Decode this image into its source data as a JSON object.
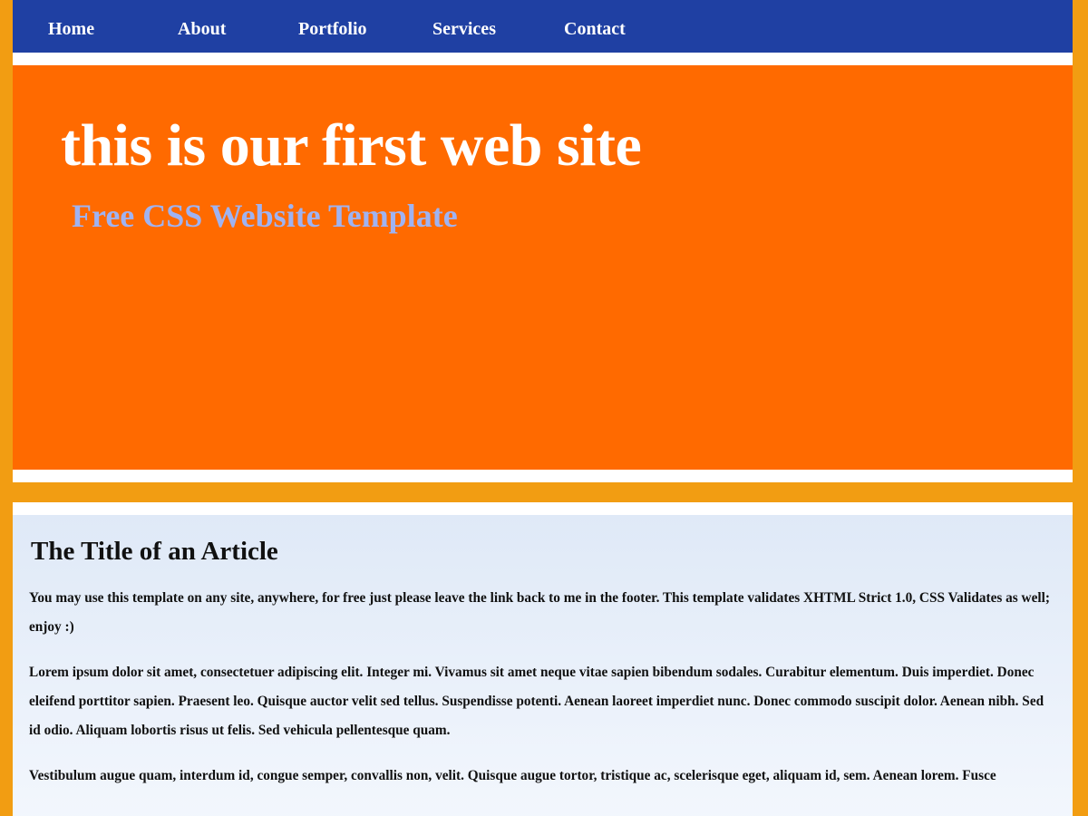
{
  "nav": {
    "items": [
      {
        "label": "Home"
      },
      {
        "label": "About"
      },
      {
        "label": "Portfolio"
      },
      {
        "label": "Services"
      },
      {
        "label": "Contact"
      }
    ]
  },
  "header": {
    "title": "this is our first web site",
    "subtitle": "Free CSS Website Template"
  },
  "article": {
    "title": "The Title of an Article",
    "paragraphs": [
      "You may use this template on any site, anywhere, for free just please leave the link back to me in the footer. This template validates XHTML Strict 1.0, CSS Validates as well; enjoy :)",
      "Lorem ipsum dolor sit amet, consectetuer adipiscing elit. Integer mi. Vivamus sit amet neque vitae sapien bibendum sodales. Curabitur elementum. Duis imperdiet. Donec eleifend porttitor sapien. Praesent leo. Quisque auctor velit sed tellus. Suspendisse potenti. Aenean laoreet imperdiet nunc. Donec commodo suscipit dolor. Aenean nibh. Sed id odio. Aliquam lobortis risus ut felis. Sed vehicula pellentesque quam.",
      "Vestibulum augue quam, interdum id, congue semper, convallis non, velit. Quisque augue tortor, tristique ac, scelerisque eget, aliquam id, sem. Aenean lorem. Fusce"
    ]
  },
  "colors": {
    "page_background": "#f29d12",
    "nav_background": "#1f40a3",
    "header_background": "#ff6a00",
    "subtitle_text": "#9fb3f2",
    "content_background": "#e8f0fa"
  }
}
